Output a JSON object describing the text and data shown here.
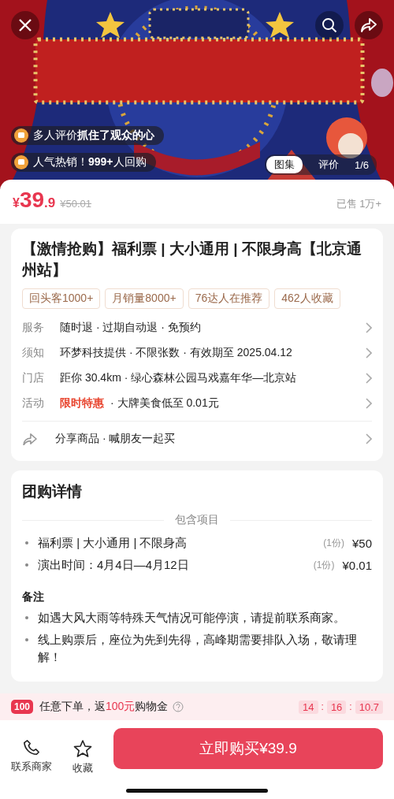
{
  "hero": {
    "kind": "picture",
    "badges": [
      {
        "text": "多人评价**抓住了观众的心**"
      },
      {
        "text": "人气热销！**999+**人回购"
      }
    ],
    "tabs": [
      {
        "label": "图集",
        "selected": true
      },
      {
        "label": "评价",
        "selected": false
      }
    ],
    "counter": "1/6"
  },
  "price": {
    "currency": "¥",
    "integer": "39",
    "decimal": ".9",
    "original": "¥50.01",
    "sold": "已售 1万+"
  },
  "product": {
    "title": "【激情抢购】福利票 | 大小通用 | 不限身高【北京通州站】",
    "tags": [
      "回头客1000+",
      "月销量8000+",
      "76达人在推荐",
      "462人收藏"
    ],
    "rows": [
      {
        "label": "服务",
        "value": "随时退 · 过期自动退 · 免预约"
      },
      {
        "label": "须知",
        "value": "环梦科技提供 · 不限张数 · 有效期至 2025.04.12"
      },
      {
        "label": "门店",
        "value": "距你 30.4km · 绿心森林公园马戏嘉年华—北京站"
      },
      {
        "label": "活动",
        "highlight": "限时特惠",
        "value": "· 大牌美食低至 0.01元"
      }
    ],
    "share": "分享商品 · 喊朋友一起买"
  },
  "details": {
    "title": "团购详情",
    "section": "包含项目",
    "items": [
      {
        "name": "福利票 | 大小通用 | 不限身高",
        "qty": "(1份)",
        "price": "¥50"
      },
      {
        "name": "演出时间：4月4日—4月12日",
        "qty": "(1份)",
        "price": "¥0.01"
      }
    ],
    "notes_title": "备注",
    "notes": [
      "如遇大风大雨等特殊天气情况可能停演，请提前联系商家。",
      "线上购票后，座位为先到先得，高峰期需要排队入场，敬请理解！"
    ]
  },
  "promo": {
    "badge": "100",
    "before": "任意下单，返",
    "amount": "100元",
    "after": "购物金",
    "countdown": [
      {
        "kind": "digit",
        "text": "14"
      },
      {
        "kind": "sep",
        "text": ":"
      },
      {
        "kind": "digit",
        "text": "16"
      },
      {
        "kind": "sep",
        "text": ":"
      },
      {
        "kind": "digit",
        "text": "10.7"
      }
    ]
  },
  "bottom": {
    "actions": [
      {
        "kind": "phone",
        "label": "联系商家"
      },
      {
        "kind": "star",
        "label": "收藏"
      }
    ],
    "buy": "立即购买¥39.9"
  }
}
